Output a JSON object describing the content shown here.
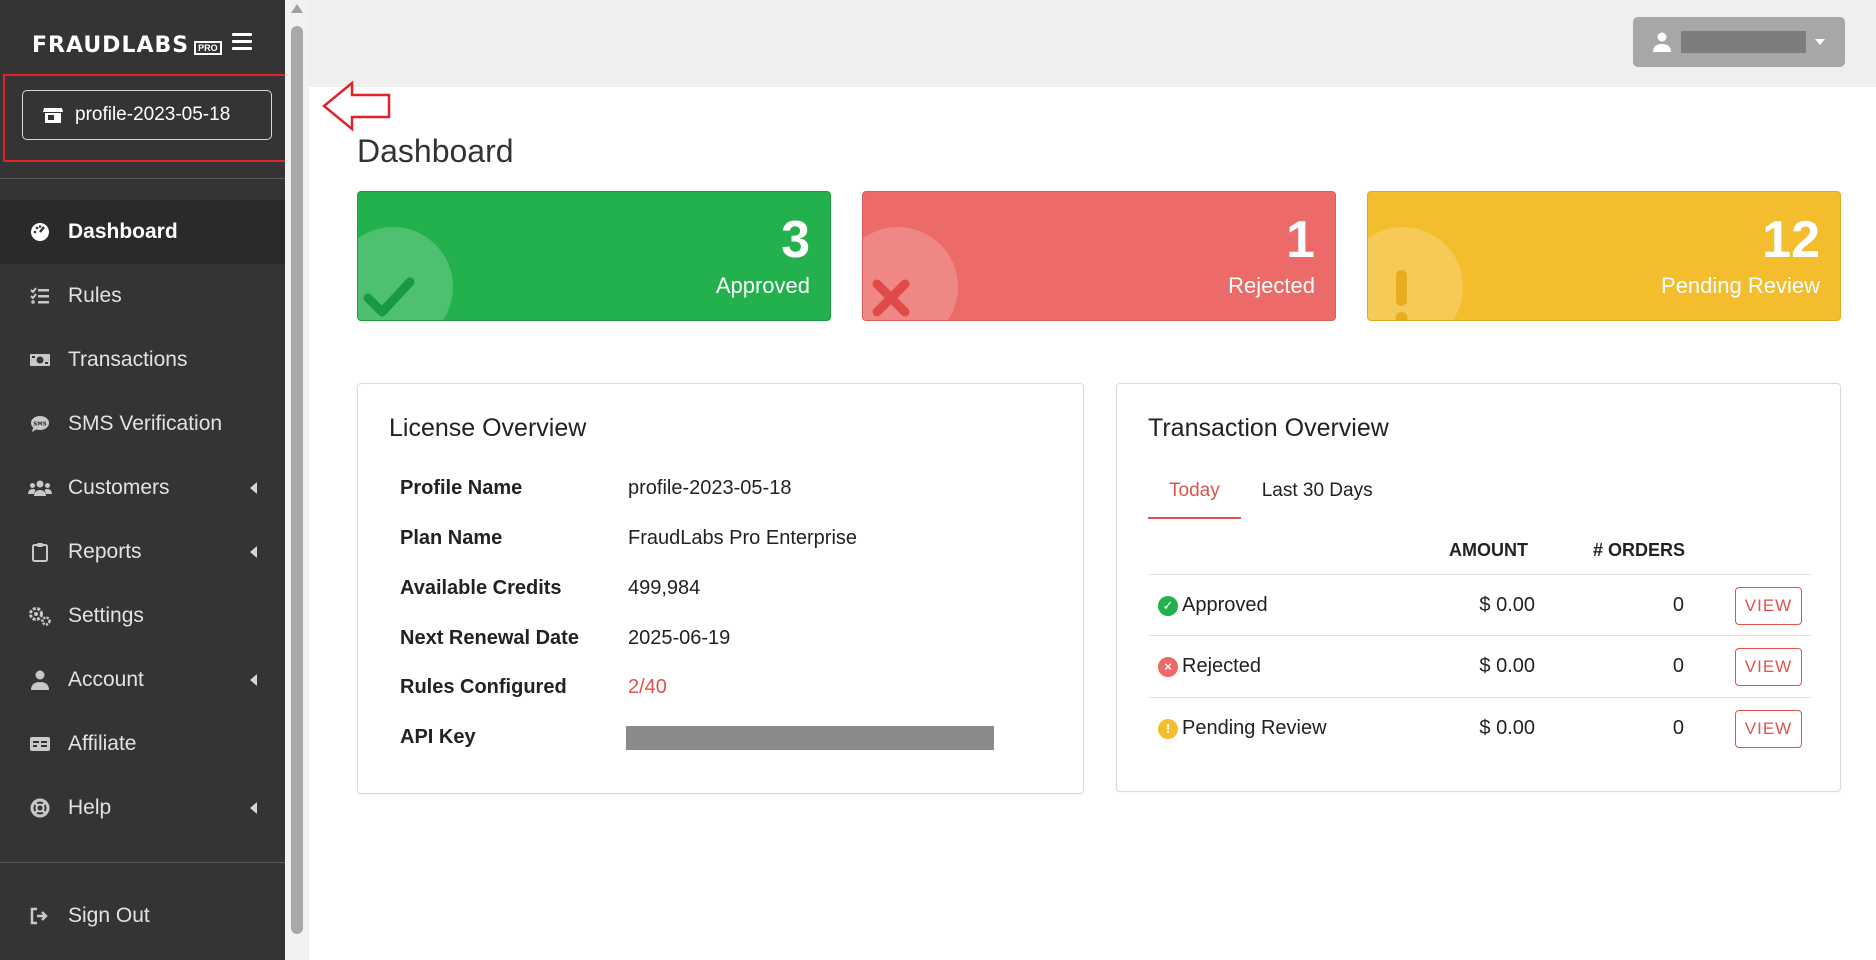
{
  "brand": {
    "name": "FRAUDLABS",
    "badge": "PRO"
  },
  "profile": {
    "label": "profile-2023-05-18",
    "icon": "store-icon"
  },
  "sidebar": {
    "items": [
      {
        "label": "Dashboard",
        "icon": "gauge-icon",
        "active": true
      },
      {
        "label": "Rules",
        "icon": "list-check-icon"
      },
      {
        "label": "Transactions",
        "icon": "money-icon"
      },
      {
        "label": "SMS Verification",
        "icon": "sms-icon"
      },
      {
        "label": "Customers",
        "icon": "users-icon",
        "submenu": true
      },
      {
        "label": "Reports",
        "icon": "clipboard-icon",
        "submenu": true
      },
      {
        "label": "Settings",
        "icon": "gears-icon"
      },
      {
        "label": "Account",
        "icon": "user-icon",
        "submenu": true
      },
      {
        "label": "Affiliate",
        "icon": "id-card-icon"
      },
      {
        "label": "Help",
        "icon": "life-ring-icon",
        "submenu": true
      }
    ],
    "signout": {
      "label": "Sign Out",
      "icon": "sign-out-icon"
    }
  },
  "page": {
    "title": "Dashboard"
  },
  "stats": {
    "approved": {
      "value": "3",
      "label": "Approved",
      "color": "#22b14c"
    },
    "rejected": {
      "value": "1",
      "label": "Rejected",
      "color": "#ec6a67"
    },
    "pending": {
      "value": "12",
      "label": "Pending Review",
      "color": "#f4bd2e"
    }
  },
  "license": {
    "title": "License Overview",
    "rows": [
      {
        "key": "Profile Name",
        "value": "profile-2023-05-18"
      },
      {
        "key": "Plan Name",
        "value": "FraudLabs Pro Enterprise"
      },
      {
        "key": "Available Credits",
        "value": "499,984"
      },
      {
        "key": "Next Renewal Date",
        "value": "2025-06-19"
      },
      {
        "key": "Rules Configured",
        "value": "2/40"
      },
      {
        "key": "API Key",
        "value": ""
      }
    ]
  },
  "transactions": {
    "title": "Transaction Overview",
    "tabs": [
      "Today",
      "Last 30 Days"
    ],
    "headers": {
      "amount": "AMOUNT",
      "orders": "# ORDERS"
    },
    "rows": [
      {
        "name": "Approved",
        "amount": "$ 0.00",
        "orders": "0",
        "action": "VIEW",
        "status_color": "#22b14c",
        "symbol": "✓"
      },
      {
        "name": "Rejected",
        "amount": "$ 0.00",
        "orders": "0",
        "action": "VIEW",
        "status_color": "#ec6a67",
        "symbol": "×"
      },
      {
        "name": "Pending Review",
        "amount": "$ 0.00",
        "orders": "0",
        "action": "VIEW",
        "status_color": "#f4bd2e",
        "symbol": "!"
      }
    ]
  }
}
